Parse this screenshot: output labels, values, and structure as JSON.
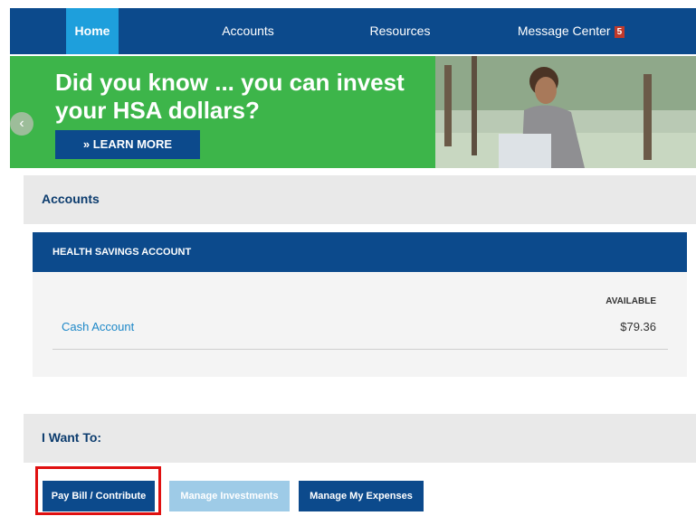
{
  "nav": {
    "items": [
      {
        "label": "Home",
        "active": true
      },
      {
        "label": "Accounts"
      },
      {
        "label": "Resources"
      },
      {
        "label": "Message Center",
        "badge": "5"
      }
    ]
  },
  "banner": {
    "headline": "Did you know ... you can invest your HSA dollars?",
    "cta_label": "» LEARN MORE",
    "prev_icon": "‹",
    "bg_color": "#3db54a"
  },
  "accounts": {
    "title": "Accounts",
    "hsa": {
      "header": "HEALTH SAVINGS ACCOUNT",
      "column_label": "AVAILABLE",
      "rows": [
        {
          "name": "Cash Account",
          "amount": "$79.36"
        }
      ]
    }
  },
  "i_want_to": {
    "title": "I Want To:",
    "actions": [
      {
        "label": "Pay Bill / Contribute",
        "enabled": true
      },
      {
        "label": "Manage Investments",
        "enabled": false
      },
      {
        "label": "Manage My Expenses",
        "enabled": true
      }
    ]
  },
  "colors": {
    "brand_navy": "#0c4a8c",
    "active_tab": "#1e9fdc",
    "link": "#1e88c8",
    "highlight": "#e01010"
  }
}
